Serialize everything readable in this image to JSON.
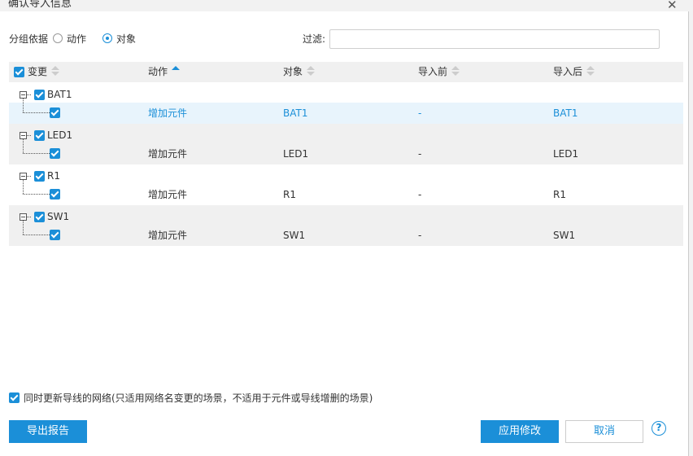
{
  "dialog": {
    "title": "确认导入信息",
    "close_glyph": "✕"
  },
  "group_by": {
    "label": "分组依据",
    "options": [
      "动作",
      "对象"
    ],
    "selected": "对象"
  },
  "filter": {
    "label": "过滤:",
    "value": "",
    "placeholder": ""
  },
  "table": {
    "columns": [
      "变更",
      "动作",
      "对象",
      "导入前",
      "导入后"
    ],
    "sort": {
      "column": "动作",
      "direction": "asc"
    },
    "groups": [
      {
        "name": "BAT1",
        "checked": true,
        "row": {
          "action": "增加元件",
          "object": "BAT1",
          "before": "-",
          "after": "BAT1",
          "checked": true
        }
      },
      {
        "name": "LED1",
        "checked": true,
        "row": {
          "action": "增加元件",
          "object": "LED1",
          "before": "-",
          "after": "LED1",
          "checked": true
        }
      },
      {
        "name": "R1",
        "checked": true,
        "row": {
          "action": "增加元件",
          "object": "R1",
          "before": "-",
          "after": "R1",
          "checked": true
        }
      },
      {
        "name": "SW1",
        "checked": true,
        "row": {
          "action": "增加元件",
          "object": "SW1",
          "before": "-",
          "after": "SW1",
          "checked": true
        }
      }
    ]
  },
  "update_net": {
    "label": "同时更新导线的网络(只适用网络名变更的场景，不适用于元件或导线增删的场景)",
    "checked": true
  },
  "footer": {
    "export_label": "导出报告",
    "apply_label": "应用修改",
    "cancel_label": "取消",
    "help_glyph": "?"
  },
  "colors": {
    "accent": "#1b8fd8",
    "header_bg": "#f0f0f0",
    "highlight_row": "#e8f4fc"
  }
}
